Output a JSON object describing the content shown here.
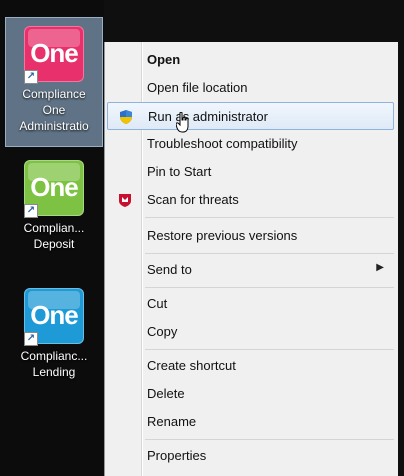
{
  "desktop": {
    "icons": [
      {
        "tile_text": "One",
        "label_lines": [
          "Compliance",
          "One",
          "Administratio"
        ],
        "color": "#e8306c",
        "selected": true
      },
      {
        "tile_text": "One",
        "label_lines": [
          "Complian...",
          "Deposit"
        ],
        "color": "#7dc242",
        "selected": false
      },
      {
        "tile_text": "One",
        "label_lines": [
          "Complianc...",
          "Lending"
        ],
        "color": "#1e9ad6",
        "selected": false
      }
    ]
  },
  "context_menu": {
    "items": [
      {
        "label": "Open",
        "bold": true
      },
      {
        "label": "Open file location"
      },
      {
        "label": "Run as administrator",
        "icon": "uac-shield-icon",
        "hover": true
      },
      {
        "label": "Troubleshoot compatibility"
      },
      {
        "label": "Pin to Start"
      },
      {
        "label": "Scan for threats",
        "icon": "mcafee-shield-icon"
      },
      {
        "label": "Restore previous versions"
      },
      {
        "label": "Send to",
        "submenu": true
      },
      {
        "label": "Cut"
      },
      {
        "label": "Copy"
      },
      {
        "label": "Create shortcut"
      },
      {
        "label": "Delete"
      },
      {
        "label": "Rename"
      },
      {
        "label": "Properties"
      }
    ],
    "submenu_glyph": "▶",
    "colors": {
      "hover_border": "#8fb3de",
      "menu_bg": "#f0f0f0",
      "mcafee_red": "#c8102e"
    }
  }
}
